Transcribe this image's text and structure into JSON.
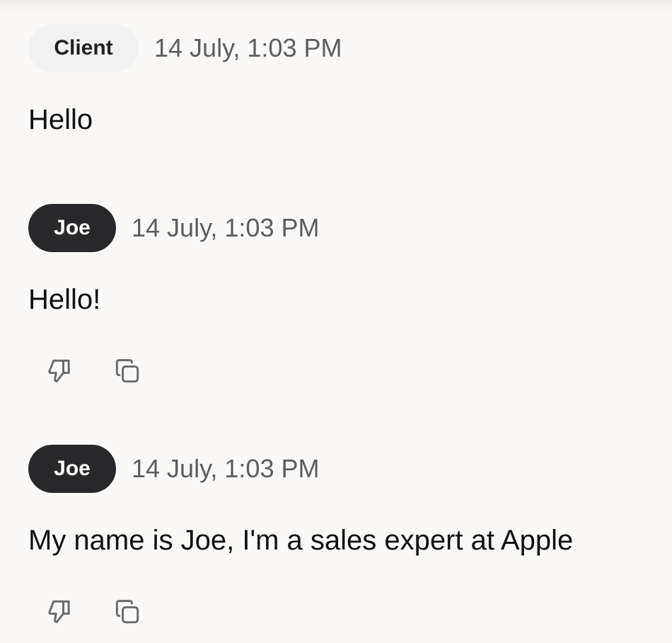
{
  "messages": [
    {
      "sender": "Client",
      "timestamp": "14 July, 1:03 PM",
      "text": "Hello",
      "has_actions": false
    },
    {
      "sender": "Joe",
      "timestamp": "14 July, 1:03 PM",
      "text": "Hello!",
      "has_actions": true
    },
    {
      "sender": "Joe",
      "timestamp": "14 July, 1:03 PM",
      "text": "My name is Joe, I'm a sales expert at Apple",
      "has_actions": true
    }
  ],
  "icons": {
    "dislike": "thumbs-down-icon",
    "copy": "copy-icon"
  },
  "colors": {
    "background": "#faf9f7",
    "client_badge_bg": "#f1f1f1",
    "agent_badge_bg": "#28282a",
    "timestamp": "#5d5d5f",
    "icon": "#6a6a6c"
  }
}
